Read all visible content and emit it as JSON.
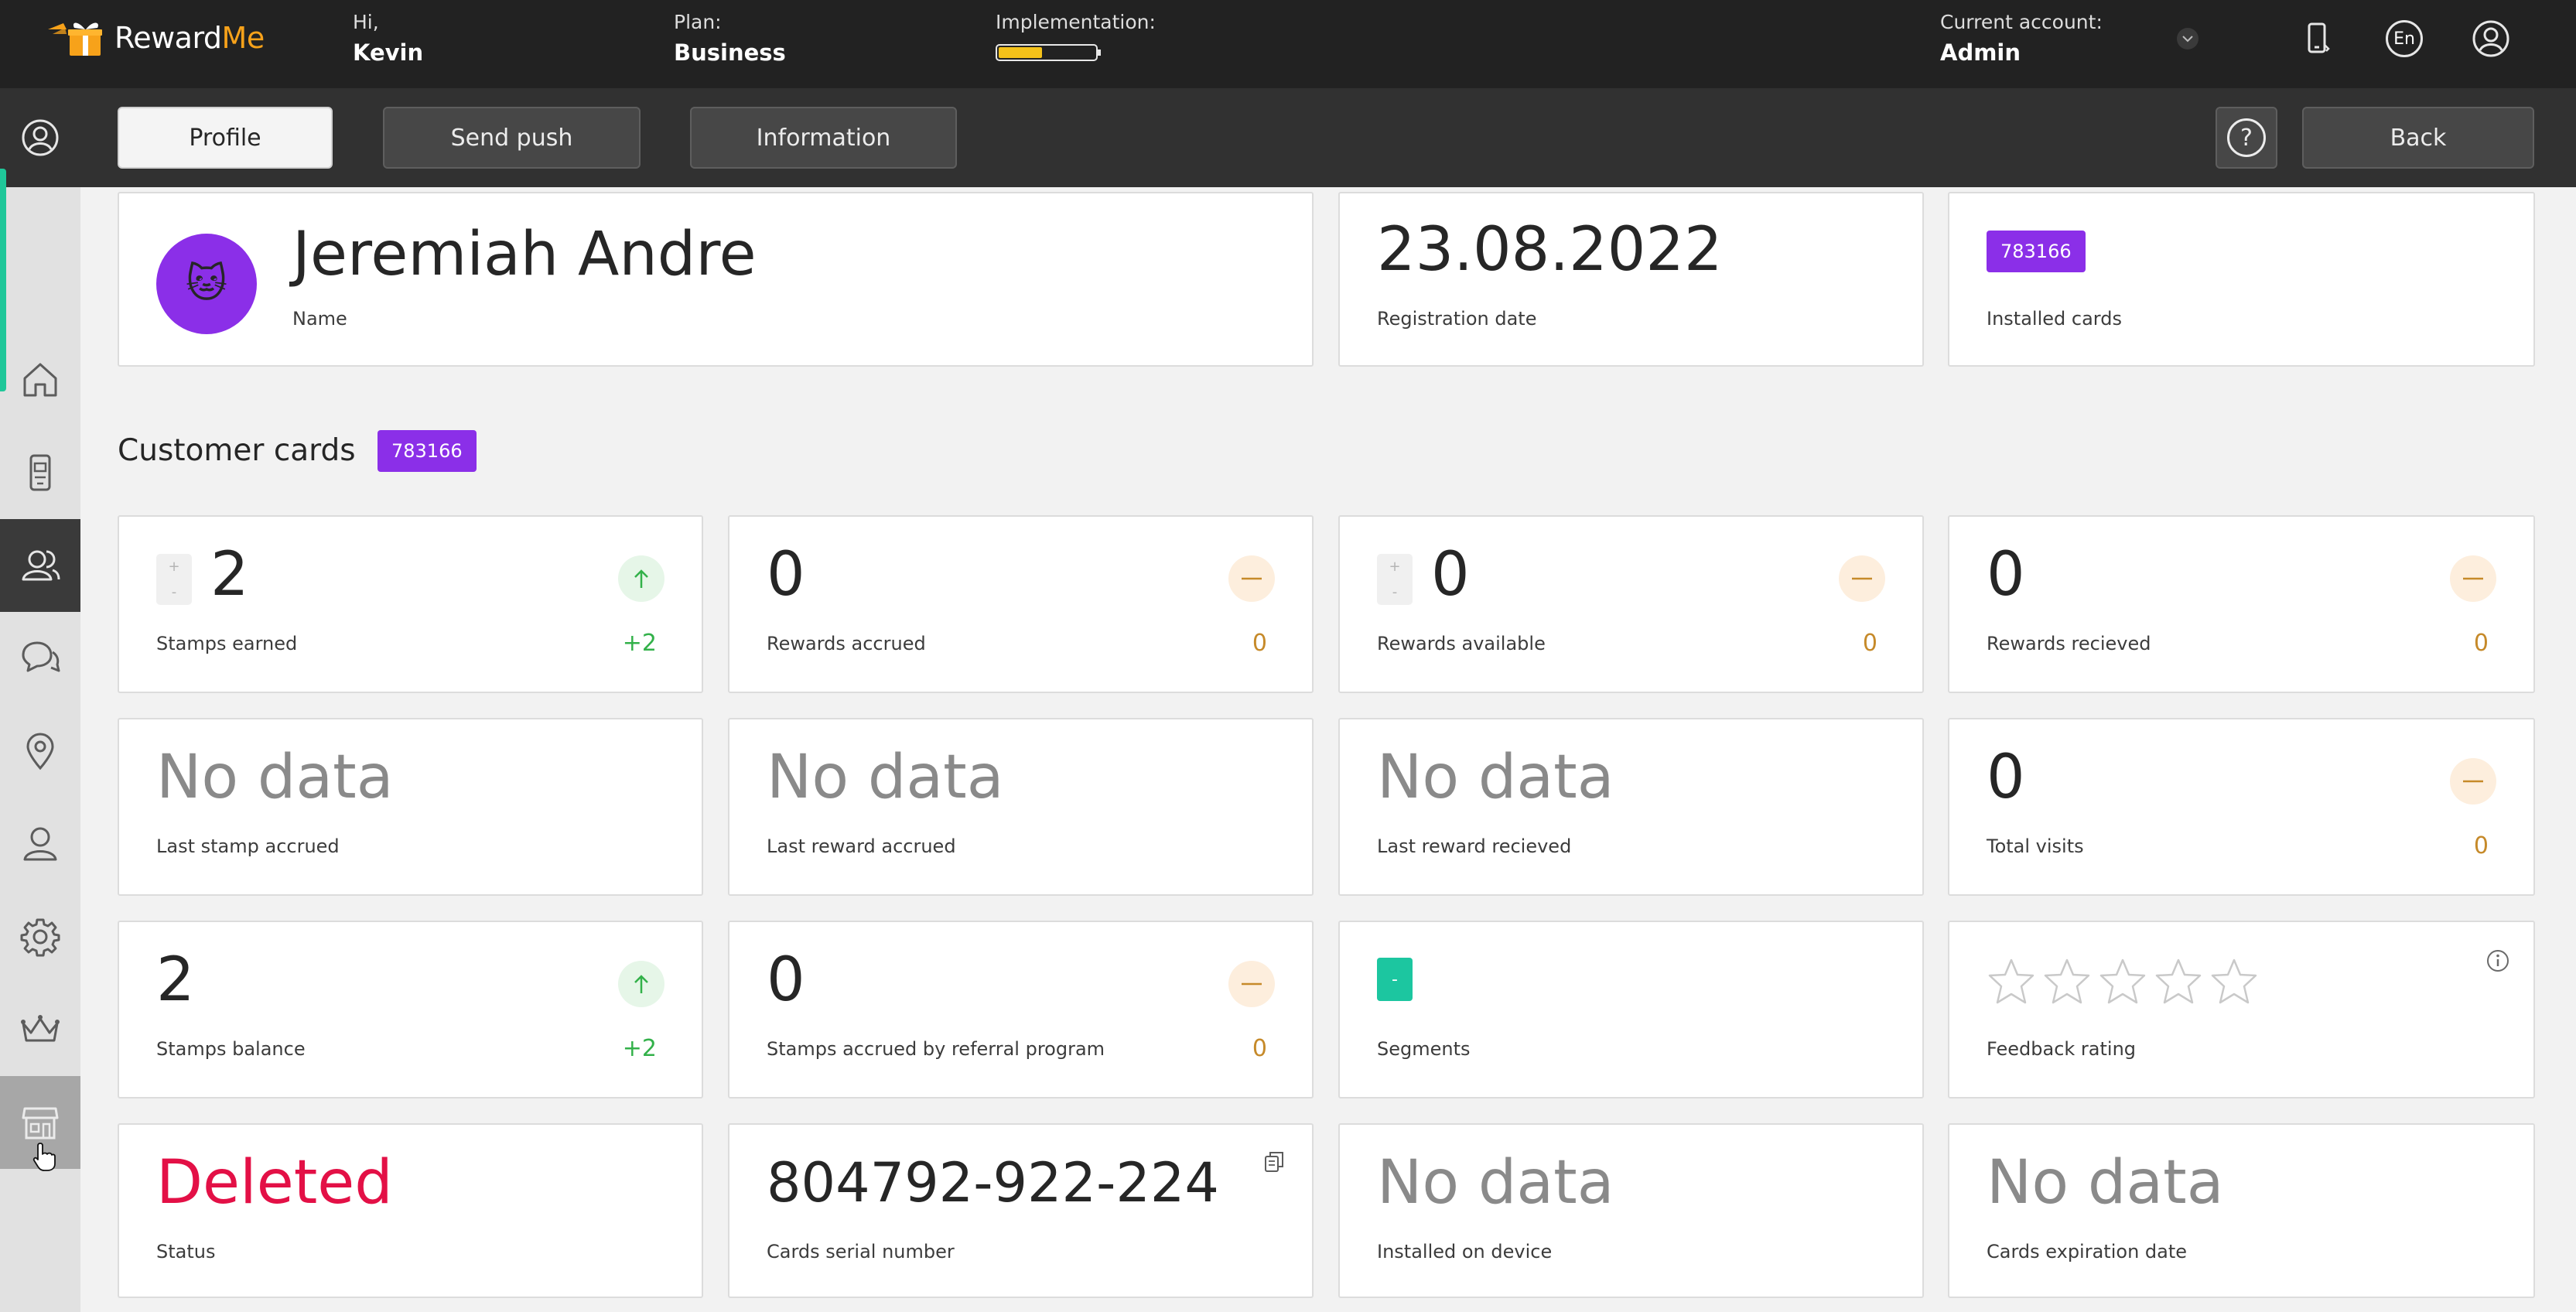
{
  "brand": {
    "name_part1": "Reward",
    "name_part2": "Me"
  },
  "header": {
    "greeting_label": "Hi,",
    "greeting_name": "Kevin",
    "plan_label": "Plan:",
    "plan_value": "Business",
    "implementation_label": "Implementation:",
    "implementation_progress": 0.45,
    "account_label": "Current account:",
    "account_value": "Admin",
    "language": "En"
  },
  "tabs": {
    "profile": "Profile",
    "send_push": "Send push",
    "information": "Information",
    "help": "?",
    "back": "Back"
  },
  "sidebar": {
    "items": [
      "profile-icon",
      "home-icon",
      "card-device-icon",
      "customers-icon",
      "chat-icon",
      "location-icon",
      "user-icon",
      "settings-icon",
      "crown-icon",
      "store-icon"
    ],
    "active": "customers-icon",
    "hovered": "store-icon"
  },
  "profile": {
    "avatar": "🐱",
    "name": "Jeremiah Andre",
    "name_label": "Name",
    "registration_date": "23.08.2022",
    "registration_label": "Registration date",
    "installed_cards_badge": "783166",
    "installed_cards_label": "Installed cards"
  },
  "customer_cards": {
    "title": "Customer cards",
    "badge": "783166"
  },
  "stats": {
    "stamps_earned": {
      "value": "2",
      "label": "Stamps earned",
      "delta": "+2"
    },
    "rewards_accrued": {
      "value": "0",
      "label": "Rewards accrued",
      "delta": "0"
    },
    "rewards_available": {
      "value": "0",
      "label": "Rewards available",
      "delta": "0"
    },
    "rewards_received": {
      "value": "0",
      "label": "Rewards recieved",
      "delta": "0"
    },
    "last_stamp": {
      "value": "No data",
      "label": "Last stamp accrued"
    },
    "last_reward_accrued": {
      "value": "No data",
      "label": "Last reward accrued"
    },
    "last_reward_received": {
      "value": "No data",
      "label": "Last reward recieved"
    },
    "total_visits": {
      "value": "0",
      "label": "Total visits",
      "delta": "0"
    },
    "stamps_balance": {
      "value": "2",
      "label": "Stamps balance",
      "delta": "+2"
    },
    "referral_stamps": {
      "value": "0",
      "label": "Stamps accrued by referral program",
      "delta": "0"
    },
    "segments": {
      "badge": "-",
      "label": "Segments"
    },
    "feedback": {
      "label": "Feedback rating",
      "stars": 0,
      "max_stars": 5
    },
    "status": {
      "value": "Deleted",
      "label": "Status"
    },
    "serial": {
      "value": "804792-922-224",
      "label": "Cards serial number"
    },
    "device": {
      "value": "No data",
      "label": "Installed on device"
    },
    "expiration": {
      "value": "No data",
      "label": "Cards expiration date"
    }
  },
  "stepper": {
    "plus": "+",
    "minus": "-"
  },
  "colors": {
    "accent_green": "#1fc799",
    "brand_purple": "#8b2fe8",
    "status_red": "#e31046",
    "positive_green": "#33b14a",
    "neutral_orange": "#c68a2a",
    "segment_teal": "#1cc6a0"
  }
}
